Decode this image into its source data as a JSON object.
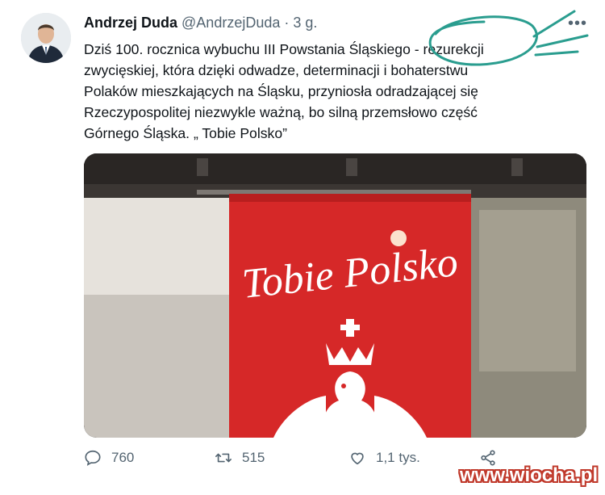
{
  "tweet": {
    "author_name": "Andrzej Duda",
    "handle": "@AndrzejDuda",
    "separator": "·",
    "time": "3 g.",
    "text": "Dziś 100. rocznica wybuchu III Powstania Śląskiego - rezurekcji zwycięskiej, która dzięki odwadze, determinacji i bohaterstwu Polaków mieszkających na Śląsku, przyniosła odradzającej się Rzeczypospolitej niezwykle ważną, bo silną przemsłowo część Górnego Śląska. „ Tobie Polsko”",
    "more_icon": "more-dots-icon"
  },
  "media": {
    "banner_text": "Tobie Polsko",
    "banner_color": "#d62828",
    "emblem": "white-eagle-crowned"
  },
  "actions": {
    "reply_count": "760",
    "retweet_count": "515",
    "like_count": "1,1 tys.",
    "reply_icon": "reply-icon",
    "retweet_icon": "retweet-icon",
    "like_icon": "heart-icon",
    "share_icon": "share-icon"
  },
  "watermark": {
    "text": "www.wiocha.pl"
  },
  "colors": {
    "secondary_text": "#536471",
    "annotation": "#2a9d8f"
  }
}
